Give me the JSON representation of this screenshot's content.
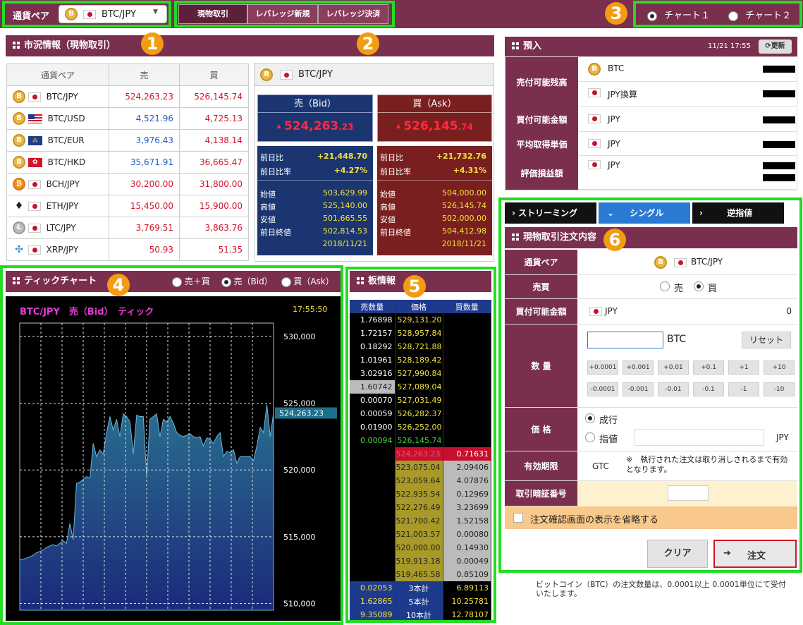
{
  "topbar": {
    "pair_label": "通貨ペア",
    "pair_value": "BTC/JPY",
    "tabs": [
      "現物取引",
      "レバレッジ新規",
      "レバレッジ決済"
    ],
    "chart_options": [
      "チャート１",
      "チャート２"
    ]
  },
  "badges": [
    "1",
    "2",
    "3",
    "4",
    "5",
    "6"
  ],
  "market": {
    "title": "市況情報（現物取引）",
    "headers": [
      "通貨ペア",
      "売",
      "買"
    ],
    "rows": [
      {
        "coin": "B",
        "flag": "jp",
        "pair": "BTC/JPY",
        "sell": "524,263.23",
        "buy": "526,145.74",
        "sell_color": "red",
        "buy_color": "red"
      },
      {
        "coin": "B",
        "flag": "us",
        "pair": "BTC/USD",
        "sell": "4,521.96",
        "buy": "4,725.13",
        "sell_color": "blue",
        "buy_color": "red"
      },
      {
        "coin": "B",
        "flag": "eu",
        "pair": "BTC/EUR",
        "sell": "3,976.43",
        "buy": "4,138.14",
        "sell_color": "blue",
        "buy_color": "red"
      },
      {
        "coin": "B",
        "flag": "hk",
        "pair": "BTC/HKD",
        "sell": "35,671.91",
        "buy": "36,665.47",
        "sell_color": "blue",
        "buy_color": "red"
      },
      {
        "coin": "B",
        "flag": "jp",
        "pair": "BCH/JPY",
        "sell": "30,200.00",
        "buy": "31,800.00",
        "sell_color": "red",
        "buy_color": "red"
      },
      {
        "coin": "E",
        "flag": "jp",
        "pair": "ETH/JPY",
        "sell": "15,450.00",
        "buy": "15,900.00",
        "sell_color": "red",
        "buy_color": "red"
      },
      {
        "coin": "L",
        "flag": "jp",
        "pair": "LTC/JPY",
        "sell": "3,769.51",
        "buy": "3,863.76",
        "sell_color": "red",
        "buy_color": "red"
      },
      {
        "coin": "X",
        "flag": "jp",
        "pair": "XRP/JPY",
        "sell": "50.93",
        "buy": "51.35",
        "sell_color": "red",
        "buy_color": "red"
      }
    ]
  },
  "quote": {
    "pair": "BTC/JPY",
    "bid_label": "売（Bid）",
    "ask_label": "買（Ask）",
    "bid_main": "524,263",
    "bid_dec": ".23",
    "ask_main": "526,145",
    "ask_dec": ".74",
    "labels": [
      "前日比",
      "前日比率",
      "始値",
      "高値",
      "安値",
      "前日終値"
    ],
    "bid_values": [
      "+21,448.70",
      "+4.27%",
      "503,629.99",
      "525,140.00",
      "501,665.55",
      "502,814.53"
    ],
    "ask_values": [
      "+21,732.76",
      "+4.31%",
      "504,000.00",
      "526,145.74",
      "502,000.00",
      "504,412.98"
    ],
    "date": "2018/11/21"
  },
  "deposit": {
    "title": "預入",
    "time": "11/21 17:55",
    "refresh": "更新",
    "rows": [
      {
        "label": "売付可能残高",
        "items": [
          "BTC",
          "JPY換算"
        ]
      },
      {
        "label": "買付可能金額",
        "items": [
          "JPY"
        ]
      },
      {
        "label": "平均取得単価",
        "items": [
          "JPY"
        ]
      },
      {
        "label": "評価損益額",
        "items": [
          "JPY"
        ]
      }
    ]
  },
  "tick": {
    "title": "ティックチャート",
    "radios": [
      "売＋買",
      "売（Bid）",
      "買（Ask）"
    ],
    "chart_title": "BTC/JPY　売（Bid）　ティック",
    "time": "17:55:50",
    "price_tag": "524,263.23"
  },
  "chart_data": {
    "type": "area",
    "title": "BTC/JPY　売（Bid）　ティック",
    "y_ticks": [
      "530,000",
      "525,000",
      "520,000",
      "515,000",
      "510,000"
    ],
    "ylim": [
      509500,
      531000
    ],
    "grid": true,
    "values": [
      513300,
      513300,
      513400,
      513500,
      513600,
      513800,
      513900,
      514000,
      514200,
      514300,
      514400,
      514300,
      514500,
      514700,
      514500,
      516000,
      514800,
      519000,
      519100,
      519300,
      519500,
      519400,
      522000,
      521000,
      521500,
      521200,
      522800,
      524000,
      523000,
      523800,
      522500,
      524200,
      524000,
      523600,
      521200,
      524100,
      524000,
      524000,
      519500,
      523800,
      524000,
      524200,
      522500,
      523800,
      523600,
      524000,
      523500,
      522800,
      522600,
      522500,
      522600,
      522700,
      522500,
      522400,
      522500,
      521800,
      522400,
      522300,
      522000,
      522500,
      522800,
      521000,
      521400,
      521300,
      521500,
      520500,
      521000,
      521000,
      521000,
      521000,
      520700,
      521800,
      523200,
      522800,
      524900,
      522500,
      524263
    ]
  },
  "orderbook": {
    "title": "板情報",
    "headers": [
      "売数量",
      "価格",
      "買数量"
    ],
    "asks": [
      [
        "1.76898",
        "529,131.20"
      ],
      [
        "1.72157",
        "528,957.84"
      ],
      [
        "0.18292",
        "528,721.88"
      ],
      [
        "1.01961",
        "528,189.42"
      ],
      [
        "3.02916",
        "527,990.84"
      ],
      [
        "1.60742",
        "527,089.04"
      ],
      [
        "0.00070",
        "527,031.49"
      ],
      [
        "0.00059",
        "526,282.37"
      ],
      [
        "0.01900",
        "526,252.00"
      ],
      [
        "0.00094",
        "526,145.74"
      ]
    ],
    "bids": [
      [
        "524,263.23",
        "0.71631"
      ],
      [
        "523,075.04",
        "2.09406"
      ],
      [
        "523,059.64",
        "4.07876"
      ],
      [
        "522,935.54",
        "0.12969"
      ],
      [
        "522,276.49",
        "3.23699"
      ],
      [
        "521,700.42",
        "1.52158"
      ],
      [
        "521,003.57",
        "0.00080"
      ],
      [
        "520,000.00",
        "0.14930"
      ],
      [
        "519,913.18",
        "0.00049"
      ],
      [
        "519,465.58",
        "0.85109"
      ]
    ],
    "totals": [
      [
        "0.02053",
        "3本計",
        "6.89113"
      ],
      [
        "1.62865",
        "5本計",
        "10.25781"
      ],
      [
        "9.35089",
        "10本計",
        "12.78107"
      ]
    ]
  },
  "order": {
    "tabs": [
      "ストリーミング",
      "シングル",
      "逆指値"
    ],
    "title": "現物取引注文内容",
    "pair_label": "通貨ペア",
    "pair": "BTC/JPY",
    "side_label": "売買",
    "sell": "売",
    "buy": "買",
    "avail_label": "買付可能金額",
    "avail_ccy": "JPY",
    "avail_val": "0",
    "qty_label": "数 量",
    "qty_unit": "BTC",
    "reset": "リセット",
    "plus": [
      "+0.0001",
      "+0.001",
      "+0.01",
      "+0.1",
      "+1",
      "+10"
    ],
    "minus": [
      "-0.0001",
      "-0.001",
      "-0.01",
      "-0.1",
      "-1",
      "-10"
    ],
    "price_label": "価 格",
    "market": "成行",
    "limit": "指値",
    "limit_ccy": "JPY",
    "expiry_label": "有効期限",
    "expiry": "GTC",
    "expiry_note": "※　執行された注文は取り消しされるまで有効となります。",
    "pin_label": "取引暗証番号",
    "skip_confirm": "注文確認画面の表示を省略する",
    "clear": "クリア",
    "submit": "注文",
    "note_lines": [
      "ビットコイン（BTC）の注文数量は、0.0001以上 0.0001単位にて受付",
      "いたします。"
    ]
  }
}
